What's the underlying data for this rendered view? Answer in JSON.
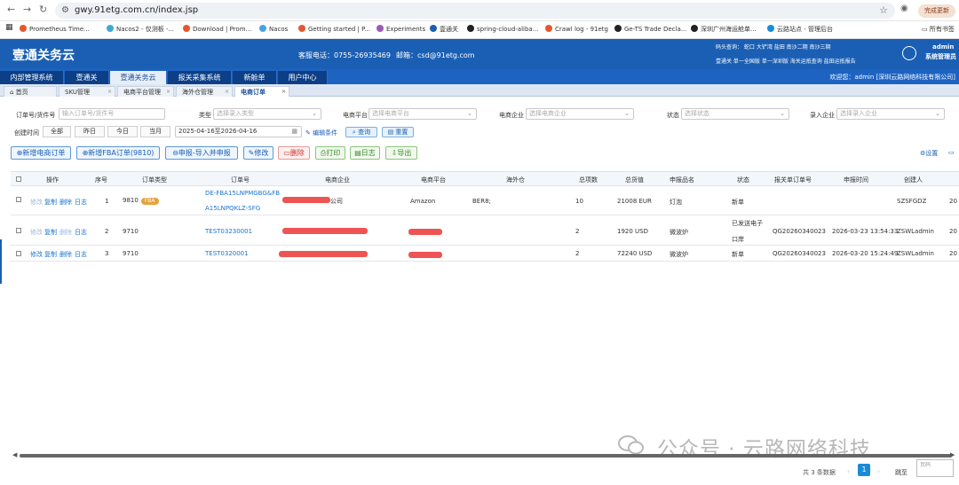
{
  "browser": {
    "url": "gwy.91etg.com.cn/index.jsp",
    "update_label": "完成更新",
    "all_bookmarks": "所有书签",
    "bookmarks": [
      "Prometheus Time...",
      "Nacos2 - 仅测板 -...",
      "Download | Prom...",
      "Nacos",
      "Getting started | P...",
      "Experiments",
      "壹通关",
      "spring-cloud-aliba...",
      "Crawl log - 91etg",
      "Ge-TS Trade Decla...",
      "深圳广州海运舱单...",
      "云路站点 - 管理后台"
    ]
  },
  "header": {
    "title": "壹通关务云",
    "hotline": "客服电话：0755-26935469",
    "email": "邮箱：csd@91etg.com",
    "quick_row1": "码头查询：   蛇口   大铲湾   盐田   南沙二期   南沙三期",
    "quick_row2": "壹通关   单一全国版   单一深圳版   海关运抵查询   盐田运抵报告",
    "user_name": "admin",
    "user_role": "系统管理员"
  },
  "modules": {
    "tabs": [
      "内部管理系统",
      "壹通关",
      "壹通关务云",
      "报关采集系统",
      "新舱单",
      "用户中心"
    ],
    "welcome": "欢迎您：admin [深圳云路网络科技有限公司]"
  },
  "page_tabs": [
    "首页",
    "SKU管理",
    "电商平台管理",
    "海外仓管理",
    "电商订单"
  ],
  "filters": {
    "order_label": "订单号/货件号",
    "order_placeholder": "输入订单号/货件号",
    "type_label": "类型",
    "type_placeholder": "选择录入类型",
    "platform_label": "电商平台",
    "platform_placeholder": "选择电商平台",
    "company_label": "电商企业",
    "company_placeholder": "选择电商企业",
    "status_label": "状态",
    "status_placeholder": "选择状态",
    "entry_label": "录入企业",
    "entry_placeholder": "选择录入企业",
    "created_label": "创建时间",
    "quick_dates": [
      "全部",
      "昨日",
      "今日",
      "当月"
    ],
    "date_range": "2025-04-16至2026-04-16",
    "edit_conditions": "编辑条件",
    "search": "查询",
    "reset": "重置"
  },
  "actions": {
    "new_order": "新增电商订单",
    "new_fba": "新增FBA订单(9810)",
    "declare": "申报-导入并申报",
    "edit": "修改",
    "delete": "删除",
    "print": "打印",
    "log": "日志",
    "export": "导出",
    "settings": "设置"
  },
  "table": {
    "headers": [
      "操作",
      "序号",
      "订单类型",
      "订单号",
      "电商企业",
      "电商平台",
      "海外仓",
      "总项数",
      "总货值",
      "申报品名",
      "状态",
      "报关单订单号",
      "申报时间",
      "创建人"
    ],
    "op_edit": "修改",
    "op_copy": "复制",
    "op_delete": "删除",
    "op_log": "日志",
    "rows": [
      {
        "seq": "1",
        "type": "9810",
        "badge": "FBA",
        "order1": "DE-FBA15LNPMGBG&FB",
        "order2": "A15LNPQKLZ-SFG",
        "company_tail": "公司",
        "platform": "Amazon",
        "warehouse": "BER8;",
        "items": "10",
        "value": "21008 EUR",
        "product": "灯泡",
        "status1": "新单",
        "status2": "",
        "decl_no": "",
        "decl_time": "",
        "creator": "SZSFGDZ",
        "extra": "20"
      },
      {
        "seq": "2",
        "type": "9710",
        "badge": "",
        "order1": "TEST03230001",
        "order2": "",
        "company_tail": "",
        "platform": "",
        "warehouse": "",
        "items": "2",
        "value": "1920 USD",
        "product": "微波炉",
        "status1": "已发送电子",
        "status2": "口岸",
        "decl_no": "QG20260340023",
        "decl_time": "2026-03-23 13:54:33",
        "creator": "ZSWLadmin",
        "extra": "20"
      },
      {
        "seq": "3",
        "type": "9710",
        "badge": "",
        "order1": "TEST0320001",
        "order2": "",
        "company_tail": "",
        "platform": "",
        "warehouse": "",
        "items": "2",
        "value": "72240 USD",
        "product": "微波炉",
        "status1": "新单",
        "status2": "",
        "decl_no": "QG20260340023",
        "decl_time": "2026-03-20 15:24:49",
        "creator": "ZSWLadmin",
        "extra": "20"
      }
    ]
  },
  "pager": {
    "total": "共 3 条数据",
    "current": "1",
    "goto": "跳至",
    "page_unit": "页码"
  },
  "watermark": "公众号 · 云路网络科技"
}
